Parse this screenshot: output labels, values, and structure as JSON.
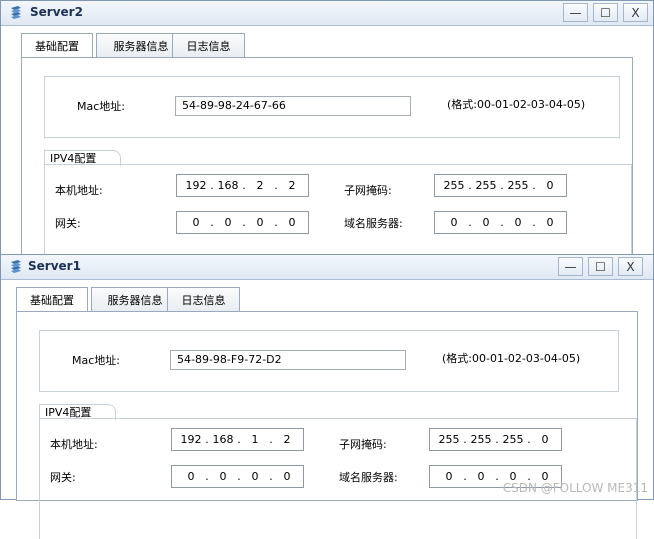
{
  "colors": {
    "title_text": "#1d3157",
    "window_border": "#7f98b6",
    "field_border": "#8f99a6"
  },
  "controls": {
    "minimize": "—",
    "maximize": "☐",
    "close": "X"
  },
  "tabs": [
    "基础配置",
    "服务器信息",
    "日志信息"
  ],
  "labels": {
    "mac": "Mac地址:",
    "mac_hint": "(格式:00-01-02-03-04-05)",
    "ipv4": "IPV4配置",
    "ip": "本机地址:",
    "gateway": "网关:",
    "mask": "子网掩码:",
    "dns": "域名服务器:"
  },
  "server2": {
    "title": "Server2",
    "mac": "54-89-98-24-67-66",
    "ip": [
      "192",
      "168",
      "2",
      "2"
    ],
    "mask": [
      "255",
      "255",
      "255",
      "0"
    ],
    "gateway": [
      "0",
      "0",
      "0",
      "0"
    ],
    "dns": [
      "0",
      "0",
      "0",
      "0"
    ]
  },
  "server1": {
    "title": "Server1",
    "mac": "54-89-98-F9-72-D2",
    "ip": [
      "192",
      "168",
      "1",
      "2"
    ],
    "mask": [
      "255",
      "255",
      "255",
      "0"
    ],
    "gateway": [
      "0",
      "0",
      "0",
      "0"
    ],
    "dns": [
      "0",
      "0",
      "0",
      "0"
    ]
  },
  "watermark": "CSDN @FOLLOW ME311"
}
